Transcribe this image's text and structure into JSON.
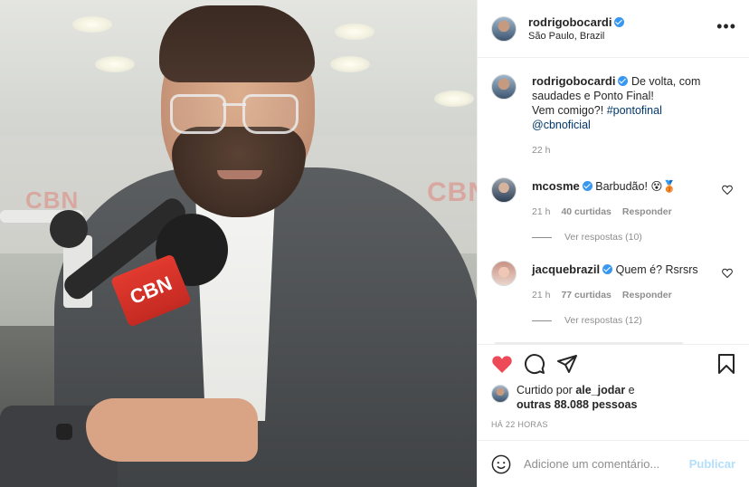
{
  "header": {
    "username": "rodrigobocardi",
    "location": "São Paulo, Brazil",
    "more_icon": "•••"
  },
  "photo": {
    "brand_text": "CBN",
    "wall_text": "CBN"
  },
  "caption": {
    "username": "rodrigobocardi",
    "text": "De volta, com saudades e Ponto Final!",
    "line2": "Vem comigo?!",
    "hashtag": "#pontofinal",
    "mention": "@cbnoficial",
    "time": "22 h"
  },
  "comments": [
    {
      "username": "mcosme",
      "text": "Barbudão! 😵🥉",
      "time": "21 h",
      "likes": "40 curtidas",
      "reply": "Responder",
      "view_replies": "Ver respostas (10)"
    },
    {
      "username": "jacquebrazil",
      "text": "Quem é? Rsrsrs",
      "time": "21 h",
      "likes": "77 curtidas",
      "reply": "Responder",
      "view_replies": "Ver respostas (12)"
    }
  ],
  "actions": {
    "liked_prefix": "Curtido por ",
    "liked_user": "ale_jodar",
    "liked_mid": " e",
    "liked_others": "outras 88.088 pessoas",
    "timestamp": "Há 22 horas"
  },
  "add_comment": {
    "placeholder": "Adicione um comentário...",
    "post_label": "Publicar"
  },
  "colors": {
    "like": "#ed4956",
    "verified": "#3897f0",
    "post_disabled": "#b2dffc",
    "link": "#00376b"
  }
}
